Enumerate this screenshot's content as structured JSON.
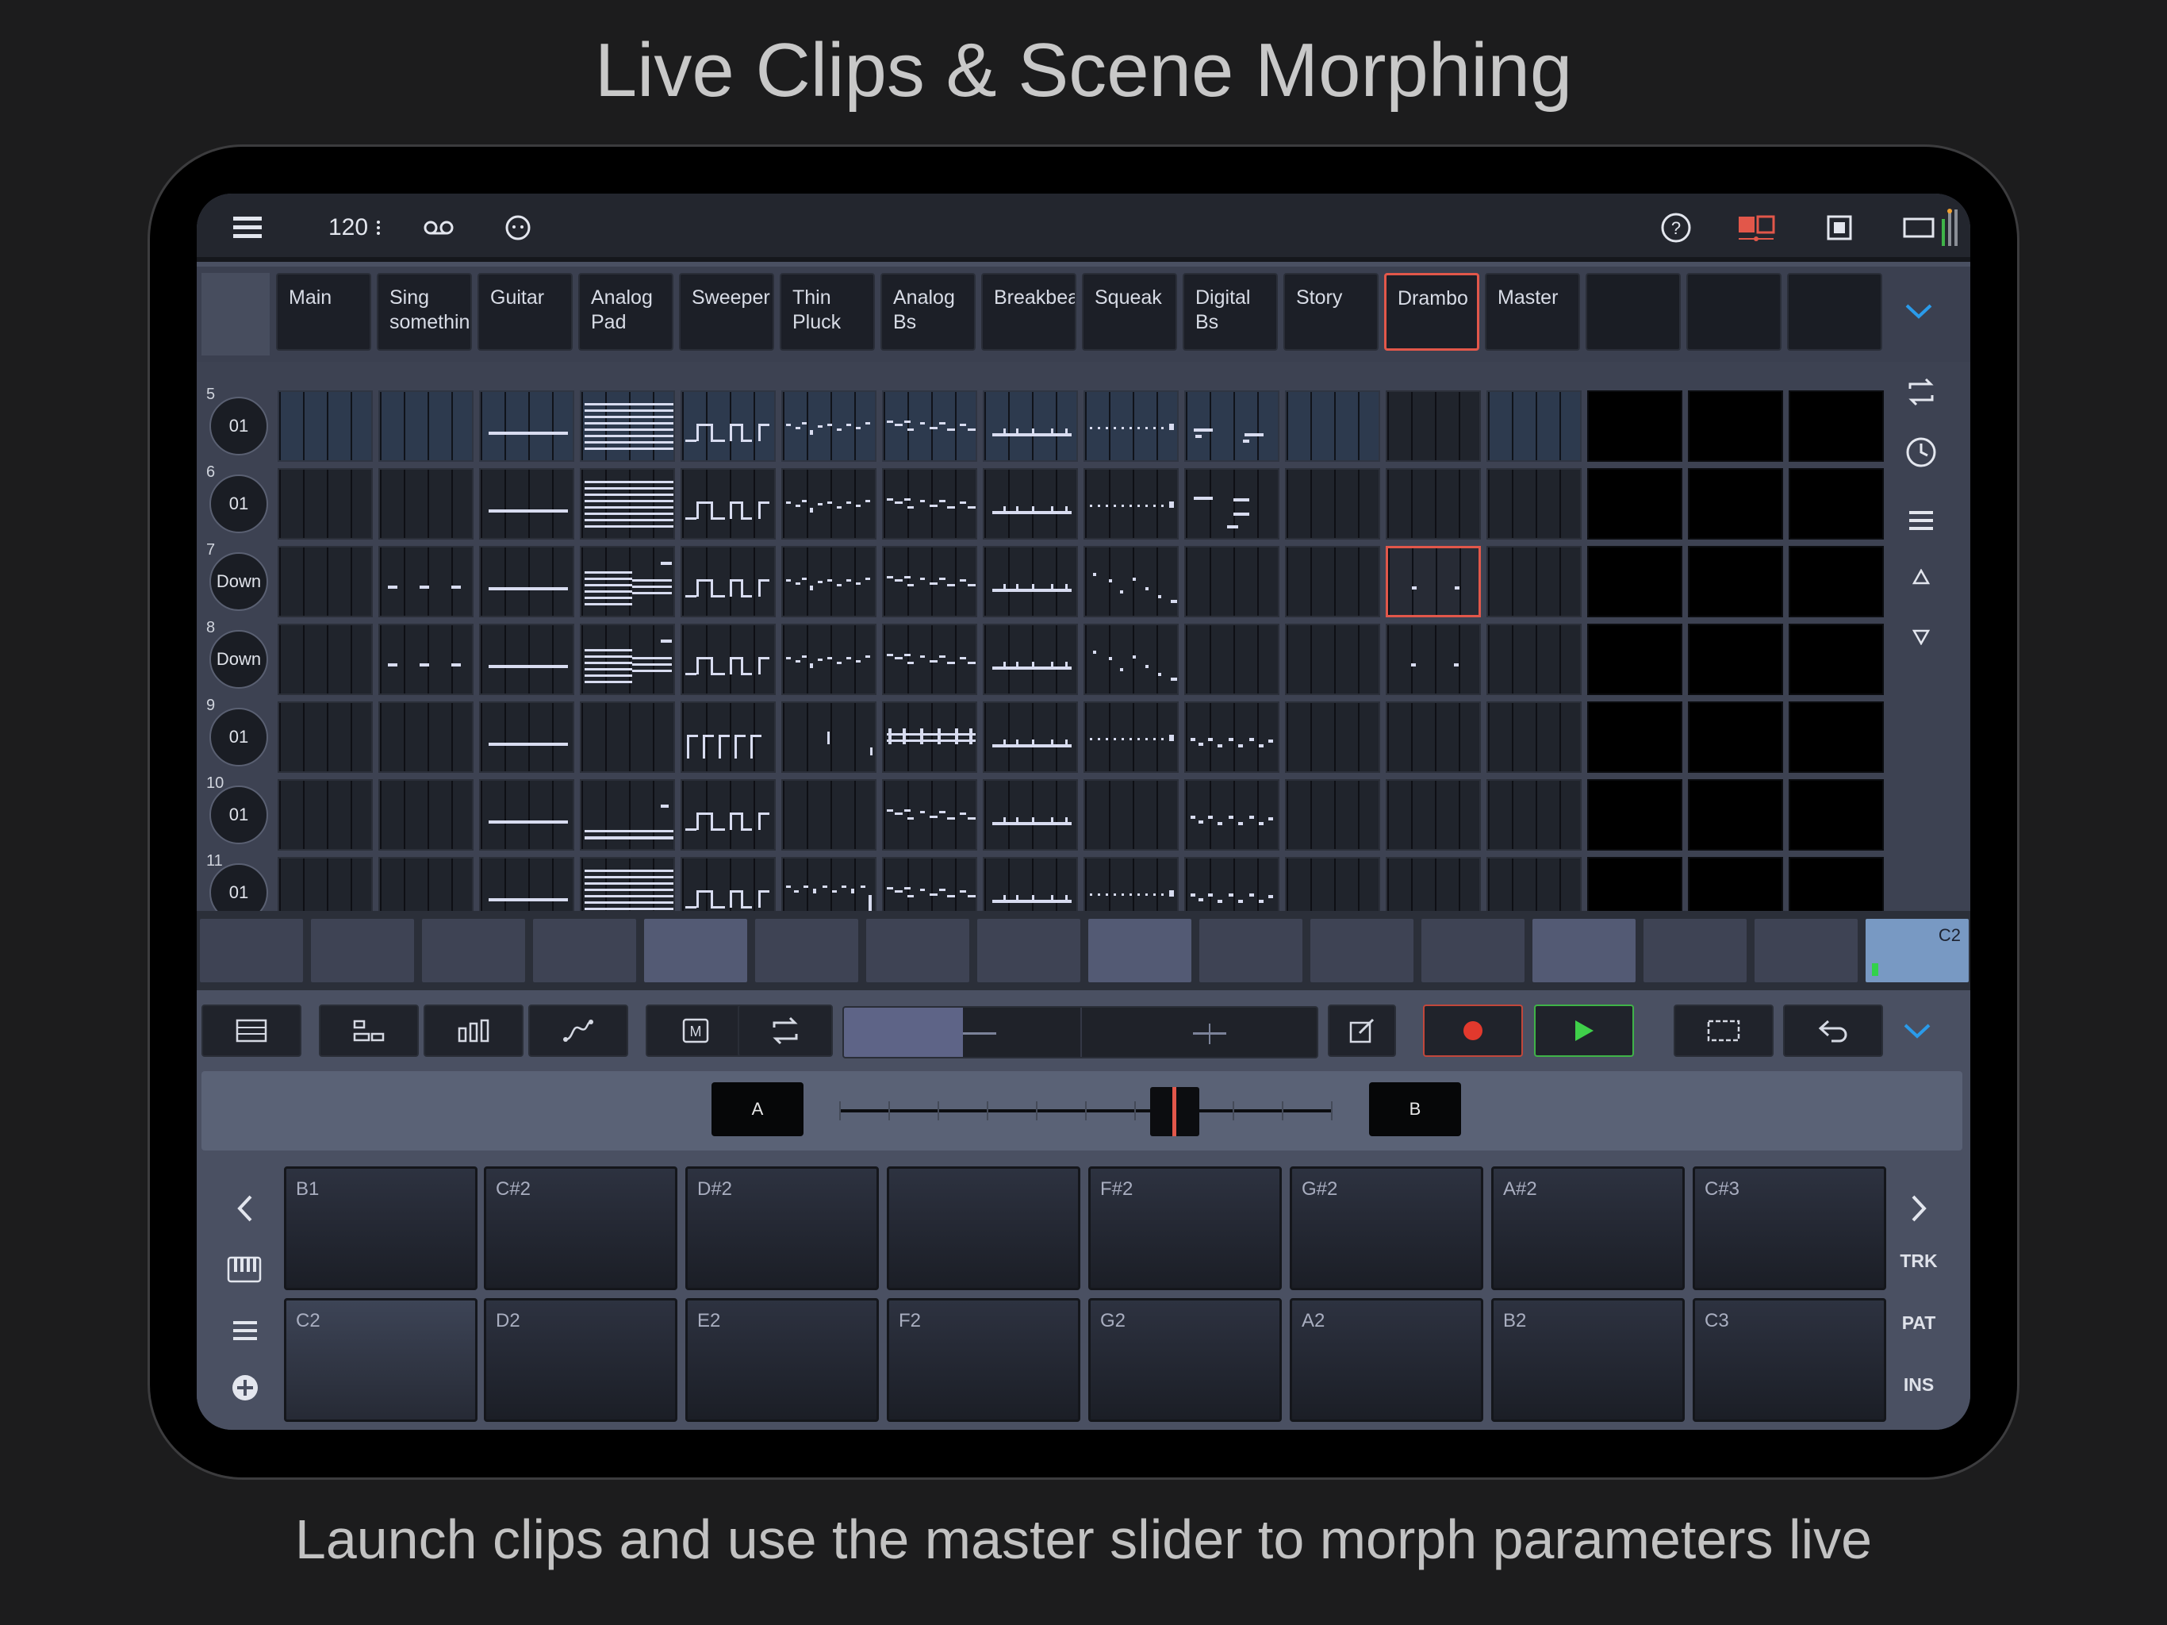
{
  "promo": {
    "title": "Live Clips & Scene Morphing",
    "subtitle": "Launch clips and use the master slider to morph parameters live"
  },
  "topbar": {
    "tempo": "120",
    "icons": [
      "hamburger-menu-icon",
      "loop-icon",
      "metronome-icon",
      "help-icon",
      "layout-icon",
      "panel-icon",
      "window-icon",
      "level-meter-icon"
    ]
  },
  "tracks": [
    {
      "label": "Main"
    },
    {
      "label": "Sing somethin"
    },
    {
      "label": "Guitar"
    },
    {
      "label": "Analog Pad"
    },
    {
      "label": "Sweeper"
    },
    {
      "label": "Thin Pluck"
    },
    {
      "label": "Analog Bs"
    },
    {
      "label": "Breakbeat"
    },
    {
      "label": "Squeak"
    },
    {
      "label": "Digital Bs"
    },
    {
      "label": "Story"
    },
    {
      "label": "Drambo",
      "selected": true
    },
    {
      "label": "Master"
    },
    {
      "label": ""
    },
    {
      "label": ""
    },
    {
      "label": ""
    }
  ],
  "rows": [
    {
      "num": "5",
      "label": "01"
    },
    {
      "num": "6",
      "label": "01"
    },
    {
      "num": "7",
      "label": "Down"
    },
    {
      "num": "8",
      "label": "Down"
    },
    {
      "num": "9",
      "label": "01"
    },
    {
      "num": "10",
      "label": "01"
    },
    {
      "num": "11",
      "label": "01"
    }
  ],
  "scene_strip": {
    "current_label": "C2",
    "scene_count": 16
  },
  "crossfader": {
    "a_label": "A",
    "b_label": "B",
    "position": 0.68
  },
  "pads": {
    "top": [
      "B1",
      "C#2",
      "D#2",
      "",
      "F#2",
      "G#2",
      "A#2",
      "C#3"
    ],
    "bottom": [
      "C2",
      "D2",
      "E2",
      "F2",
      "G2",
      "A2",
      "B2",
      "C3"
    ]
  },
  "side_labels": {
    "trk": "TRK",
    "pat": "PAT",
    "ins": "INS"
  },
  "colors": {
    "accent": "#e2574a",
    "record": "#e2392d",
    "play": "#3fb348",
    "scene_current": "#7899c3"
  }
}
